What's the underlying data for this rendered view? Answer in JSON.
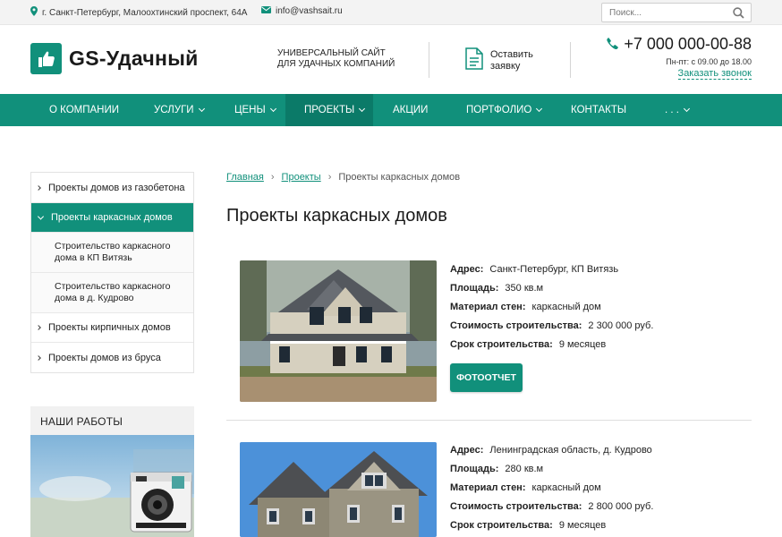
{
  "topbar": {
    "address": "г. Санкт-Петербург, Малоохтинский проспект, 64А",
    "email": "info@vashsait.ru",
    "search_placeholder": "Поиск..."
  },
  "header": {
    "logo_text": "GS-Удачный",
    "tagline_line1": "Универсальный сайт",
    "tagline_line2": "для удачных компаний",
    "order_line1": "Оставить",
    "order_line2": "заявку",
    "phone": "+7 000 000-00-88",
    "hours": "Пн-пт: с 09.00 до 18.00",
    "callback": "Заказать звонок"
  },
  "colors": {
    "accent": "#11907b",
    "accent_dark": "#0b7a68"
  },
  "nav": [
    {
      "label": "О компании",
      "has_dropdown": false,
      "active": false
    },
    {
      "label": "Услуги",
      "has_dropdown": true,
      "active": false
    },
    {
      "label": "Цены",
      "has_dropdown": true,
      "active": false
    },
    {
      "label": "Проекты",
      "has_dropdown": true,
      "active": true
    },
    {
      "label": "Акции",
      "has_dropdown": false,
      "active": false
    },
    {
      "label": "Портфолио",
      "has_dropdown": true,
      "active": false
    },
    {
      "label": "Контакты",
      "has_dropdown": false,
      "active": false
    },
    {
      "label": ". . .",
      "has_dropdown": true,
      "active": false
    }
  ],
  "sidebar": {
    "items": [
      {
        "label": "Проекты домов из газобетона"
      },
      {
        "label": "Проекты каркасных домов"
      },
      {
        "label": "Строительство каркасного дома в КП Витязь"
      },
      {
        "label": "Строительство каркасного дома в д. Кудрово"
      },
      {
        "label": "Проекты кирпичных домов"
      },
      {
        "label": "Проекты домов из бруса"
      }
    ],
    "works_title": "Наши работы"
  },
  "breadcrumb": [
    "Главная",
    "Проекты",
    "Проекты каркасных домов"
  ],
  "page_title": "Проекты каркасных домов",
  "projects": [
    {
      "props": [
        {
          "label": "Адрес:",
          "value": "Санкт-Петербург, КП Витязь"
        },
        {
          "label": "Площадь:",
          "value": "350 кв.м"
        },
        {
          "label": "Материал стен:",
          "value": "каркасный дом"
        },
        {
          "label": "Стоимость строительства:",
          "value": "2 300 000 руб."
        },
        {
          "label": "Срок строительства:",
          "value": "9 месяцев"
        }
      ],
      "button": "Фотоотчет"
    },
    {
      "props": [
        {
          "label": "Адрес:",
          "value": "Ленинградская область, д. Кудрово"
        },
        {
          "label": "Площадь:",
          "value": "280 кв.м"
        },
        {
          "label": "Материал стен:",
          "value": "каркасный дом"
        },
        {
          "label": "Стоимость строительства:",
          "value": "2 800 000 руб."
        },
        {
          "label": "Срок строительства:",
          "value": "9 месяцев"
        }
      ]
    }
  ]
}
